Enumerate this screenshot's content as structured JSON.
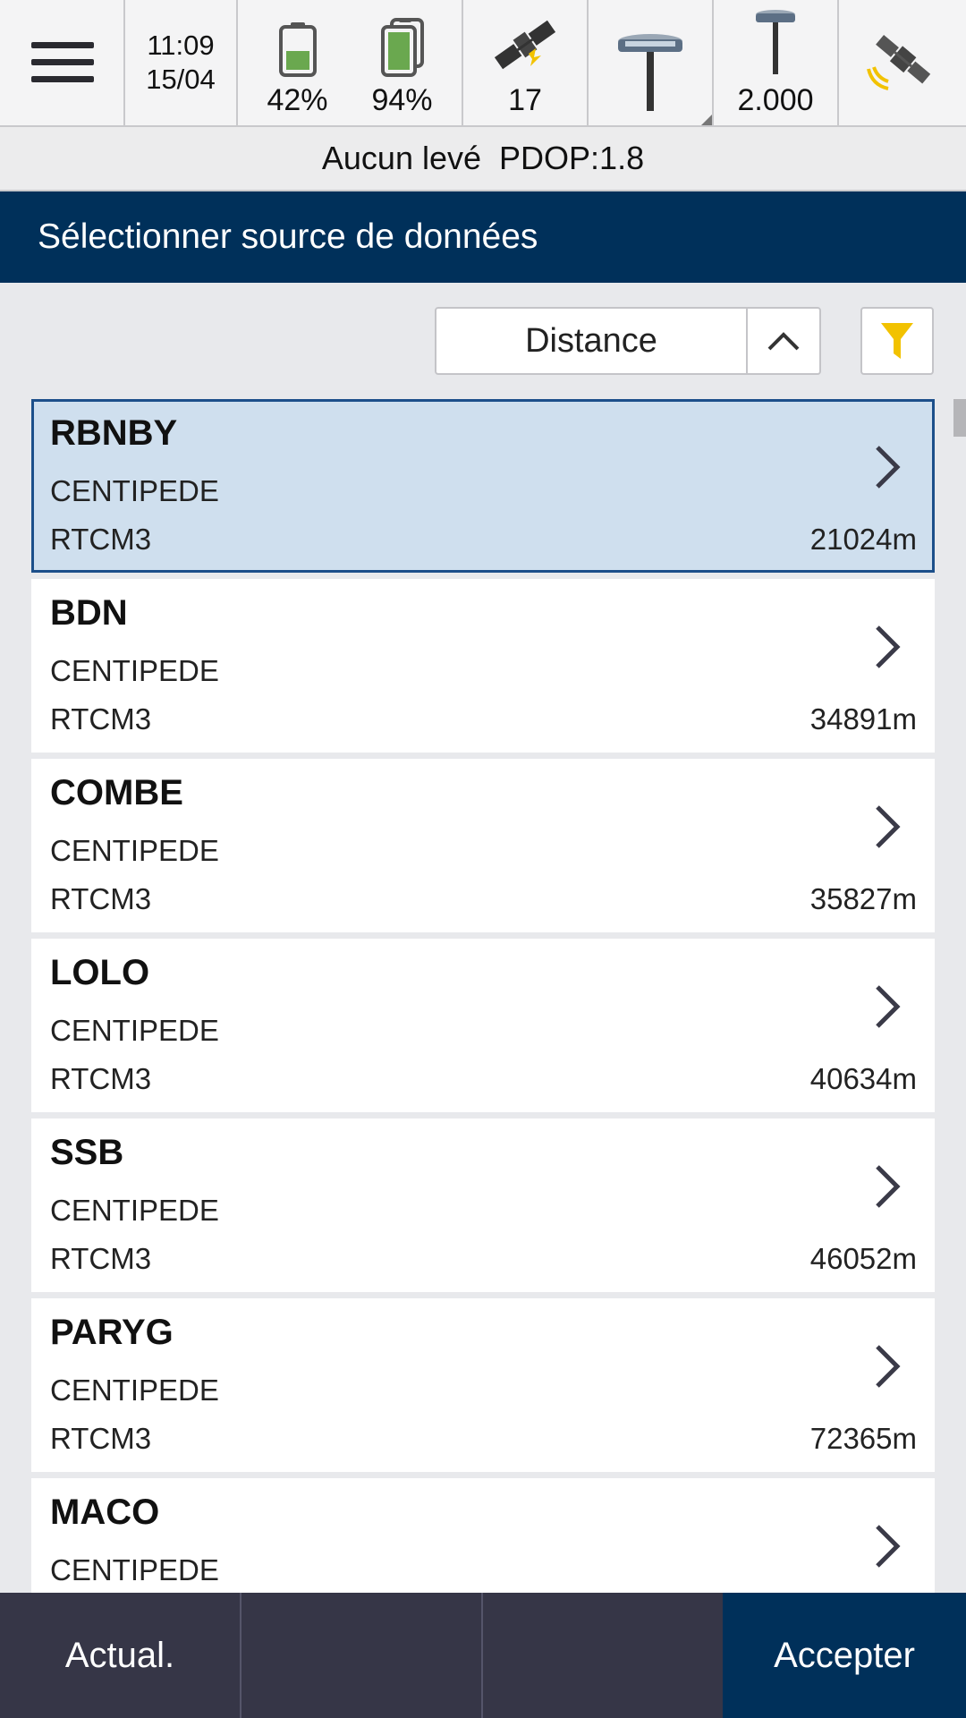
{
  "status_bar": {
    "time": "11:09",
    "date": "15/04",
    "controller_battery": "42%",
    "receiver_battery": "94%",
    "satellites": "17",
    "antenna_height": "2.000",
    "icons": [
      "menu-icon",
      "battery-icon",
      "battery-double-icon",
      "satellite-icon",
      "gnss-receiver-icon",
      "rod-icon",
      "satellite-signal-icon"
    ],
    "colors": {
      "battery_fill": "#6aa84f",
      "sat_accent": "#f2c200"
    }
  },
  "survey_status": {
    "state": "Aucun levé",
    "pdop": "PDOP:1.8"
  },
  "title": "Sélectionner source de données",
  "sort": {
    "label": "Distance",
    "direction_icon": "chevron-up-icon",
    "filter_icon": "filter-icon",
    "filter_color": "#f2c200"
  },
  "stations": [
    {
      "name": "RBNBY",
      "network": "CENTIPEDE",
      "format": "RTCM3",
      "distance": "21024m",
      "selected": true
    },
    {
      "name": "BDN",
      "network": "CENTIPEDE",
      "format": "RTCM3",
      "distance": "34891m",
      "selected": false
    },
    {
      "name": "COMBE",
      "network": "CENTIPEDE",
      "format": "RTCM3",
      "distance": "35827m",
      "selected": false
    },
    {
      "name": "LOLO",
      "network": "CENTIPEDE",
      "format": "RTCM3",
      "distance": "40634m",
      "selected": false
    },
    {
      "name": "SSB",
      "network": "CENTIPEDE",
      "format": "RTCM3",
      "distance": "46052m",
      "selected": false
    },
    {
      "name": "PARYG",
      "network": "CENTIPEDE",
      "format": "RTCM3",
      "distance": "72365m",
      "selected": false
    },
    {
      "name": "MACO",
      "network": "CENTIPEDE",
      "format": "",
      "distance": "",
      "selected": false
    }
  ],
  "bottom_bar": {
    "refresh": "Actual.",
    "empty1": "",
    "empty2": "",
    "accept": "Accepter"
  },
  "colors": {
    "header": "#00305a",
    "selected_bg": "#cfdfee",
    "selected_border": "#1c4f8a",
    "bottom_bar": "#363647"
  }
}
